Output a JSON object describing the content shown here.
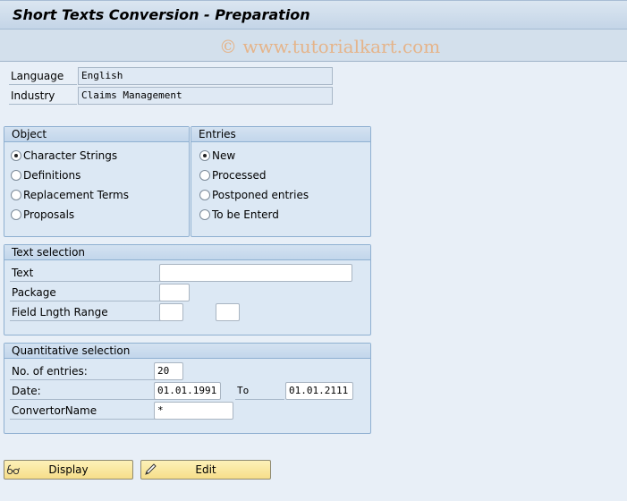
{
  "header": {
    "title": "Short Texts Conversion - Preparation",
    "watermark": "© www.tutorialkart.com"
  },
  "top_fields": {
    "language": {
      "label": "Language",
      "value": "English"
    },
    "industry": {
      "label": "Industry",
      "value": "Claims Management"
    }
  },
  "object_group": {
    "title": "Object",
    "options": [
      {
        "label": "Character Strings",
        "selected": true
      },
      {
        "label": "Definitions",
        "selected": false
      },
      {
        "label": "Replacement Terms",
        "selected": false
      },
      {
        "label": "Proposals",
        "selected": false
      }
    ]
  },
  "entries_group": {
    "title": "Entries",
    "options": [
      {
        "label": "New",
        "selected": true
      },
      {
        "label": "Processed",
        "selected": false
      },
      {
        "label": "Postponed entries",
        "selected": false
      },
      {
        "label": "To be Enterd",
        "selected": false
      }
    ]
  },
  "text_selection": {
    "title": "Text selection",
    "text": {
      "label": "Text",
      "value": ""
    },
    "package": {
      "label": "Package",
      "value": ""
    },
    "field_length_range": {
      "label": "Field Lngth Range",
      "from": "",
      "to": ""
    }
  },
  "quantitative_selection": {
    "title": "Quantitative selection",
    "num_entries": {
      "label": "No. of entries:",
      "value": "20"
    },
    "date": {
      "label": "Date:",
      "from": "01.01.1991",
      "to_label": "To",
      "to": "01.01.2111"
    },
    "convertor_name": {
      "label": "ConvertorName",
      "value": "*"
    }
  },
  "buttons": {
    "display": {
      "label": "Display",
      "icon": "glasses-icon"
    },
    "edit": {
      "label": "Edit",
      "icon": "pencil-icon"
    }
  }
}
